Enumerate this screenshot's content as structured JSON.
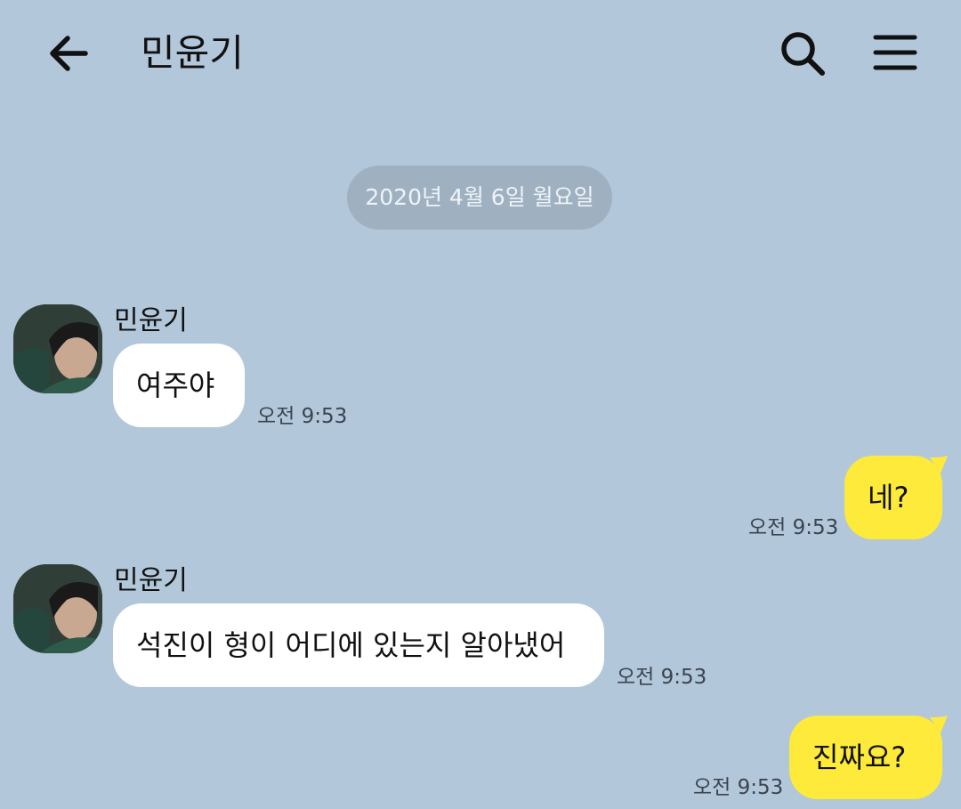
{
  "header": {
    "title": "민윤기",
    "back_icon": "arrow-left-icon",
    "search_icon": "search-icon",
    "menu_icon": "hamburger-menu-icon"
  },
  "date_divider": "2020년 4월 6일 월요일",
  "colors": {
    "background": "#b2c7da",
    "incoming_bubble": "#ffffff",
    "outgoing_bubble": "#fdea3a",
    "date_pill": "#9fb1c1"
  },
  "messages": [
    {
      "direction": "incoming",
      "sender": "민윤기",
      "text": "여주야",
      "time": "오전 9:53"
    },
    {
      "direction": "outgoing",
      "text": "네?",
      "time": "오전 9:53"
    },
    {
      "direction": "incoming",
      "sender": "민윤기",
      "text": "석진이 형이 어디에 있는지 알아냈어",
      "time": "오전 9:53"
    },
    {
      "direction": "outgoing",
      "text": "진짜요?",
      "time": "오전 9:53"
    }
  ]
}
